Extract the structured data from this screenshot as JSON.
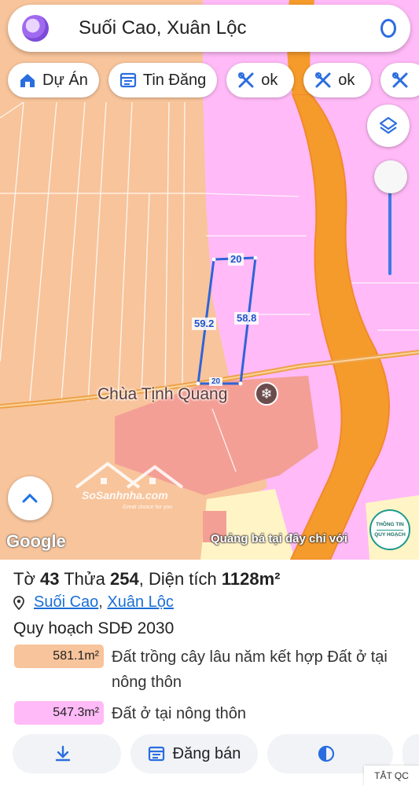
{
  "search": {
    "text": "Suối Cao, Xuân Lộc"
  },
  "chips": [
    {
      "label": "Dự Án",
      "icon": "house-icon"
    },
    {
      "label": "Tin Đăng",
      "icon": "listing-icon"
    },
    {
      "label": "ok",
      "icon": "tools-icon"
    },
    {
      "label": "ok",
      "icon": "tools-icon"
    },
    {
      "label": "",
      "icon": "tools-icon"
    }
  ],
  "map": {
    "parcel_edges": {
      "top": "20",
      "left": "59.2",
      "right": "58.8",
      "bottom": "20"
    },
    "place_name": "Chùa Tịnh Quang",
    "attribution": "Google",
    "ad_text": "Quảng bá tại đây chỉ với",
    "watermark": {
      "brand": "SoSanhnha.com",
      "slogan": "Great choice for you"
    },
    "info_badge": {
      "line1": "THÔNG TIN",
      "line2": "QUY HOẠCH"
    },
    "colors": {
      "agricultural": "#f8c49b",
      "residential": "#ffbaf7",
      "road": "#f59b2b",
      "religious": "#f49f95",
      "commercial": "#fff4c6"
    }
  },
  "panel": {
    "title": {
      "sheet_label": "Tờ",
      "sheet": "43",
      "plot_label": "Thửa",
      "plot": "254",
      "area_label": "Diện tích",
      "area": "1128m²"
    },
    "location": {
      "commune": "Suối Cao",
      "separator": ", ",
      "district": "Xuân Lộc"
    },
    "plan_title": "Quy hoạch SDĐ 2030",
    "zones": [
      {
        "area": "581.1m²",
        "color": "#f8c49b",
        "desc": "Đất trồng cây lâu năm kết hợp Đất ở tại nông thôn"
      },
      {
        "area": "547.3m²",
        "color": "#ffbaf7",
        "desc": "Đất ở tại nông thôn"
      }
    ],
    "actions": [
      {
        "label": "",
        "icon": "download-icon"
      },
      {
        "label": "Đăng bán",
        "icon": "calendar-icon"
      },
      {
        "label": "",
        "icon": "contrast-icon"
      },
      {
        "label": "",
        "icon": "more-icon"
      }
    ],
    "ad_close": "TẮT QC"
  }
}
